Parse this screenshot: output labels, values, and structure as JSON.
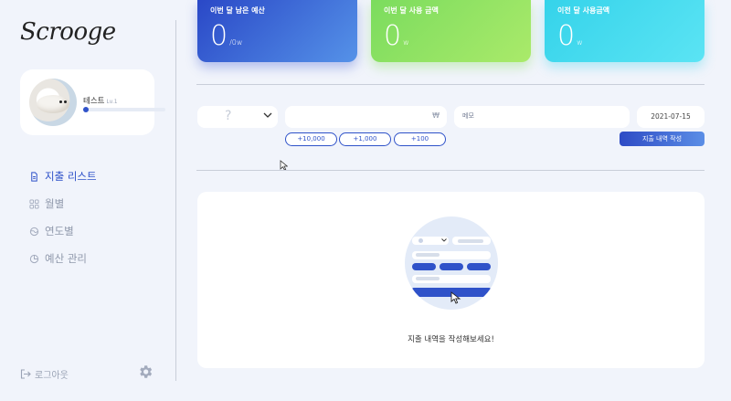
{
  "app": {
    "logo": "Scrooge"
  },
  "profile": {
    "name": "테스트",
    "level": "Lv.1"
  },
  "nav": {
    "items": [
      {
        "label": "지출 리스트"
      },
      {
        "label": "월별"
      },
      {
        "label": "연도별"
      },
      {
        "label": "예산 관리"
      }
    ]
  },
  "footer": {
    "logout_label": "로그아웃"
  },
  "cards": {
    "budget": {
      "title": "이번 달 남은 예산",
      "value": "0",
      "unit": "/0w"
    },
    "spent": {
      "title": "이번 달 사용 금액",
      "value": "0",
      "unit": "w"
    },
    "last": {
      "title": "이전 달 사용금액",
      "value": "0",
      "unit": "w"
    }
  },
  "form": {
    "category_placeholder": "?",
    "amount_symbol": "₩",
    "memo_placeholder": "메모",
    "date_value": "2021-07-15",
    "quick_amounts": [
      "+10,000",
      "+1,000",
      "+100"
    ],
    "submit_label": "지출 내역 작성"
  },
  "empty_state": {
    "message": "지출 내역을 작성해보세요!"
  },
  "colors": {
    "accent": "#2f52c9",
    "green": "#8ee063",
    "cyan": "#46dcef"
  }
}
